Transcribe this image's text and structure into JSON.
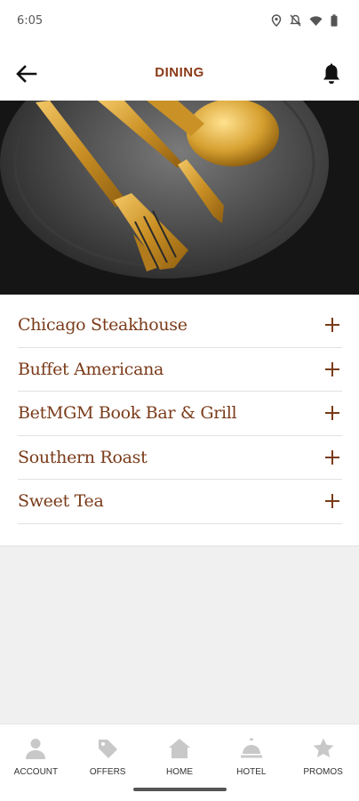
{
  "status_bar": {
    "time": "6:05",
    "icons": [
      "location-icon",
      "notifications-off-icon",
      "wifi-icon",
      "battery-icon"
    ]
  },
  "app_bar": {
    "title": "DINING",
    "back_icon": "arrow-left-icon",
    "bell_icon": "bell-icon"
  },
  "hero": {
    "image": "gold-cutlery-on-black-plate"
  },
  "dining_list": {
    "items": [
      {
        "label": "Chicago Steakhouse",
        "icon": "plus-icon"
      },
      {
        "label": "Buffet Americana",
        "icon": "plus-icon"
      },
      {
        "label": "BetMGM Book Bar & Grill",
        "icon": "plus-icon"
      },
      {
        "label": "Southern Roast",
        "icon": "plus-icon"
      },
      {
        "label": "Sweet Tea",
        "icon": "plus-icon"
      }
    ]
  },
  "bottom_nav": {
    "items": [
      {
        "label": "ACCOUNT",
        "icon": "person-icon"
      },
      {
        "label": "OFFERS",
        "icon": "tag-icon"
      },
      {
        "label": "HOME",
        "icon": "home-icon"
      },
      {
        "label": "HOTEL",
        "icon": "service-bell-icon"
      },
      {
        "label": "PROMOS",
        "icon": "star-icon"
      }
    ]
  },
  "colors": {
    "accent": "#7a3b1a",
    "title": "#8a3a16",
    "nav_icon": "#c8c8c8",
    "gray_background": "#f0f0f0"
  }
}
